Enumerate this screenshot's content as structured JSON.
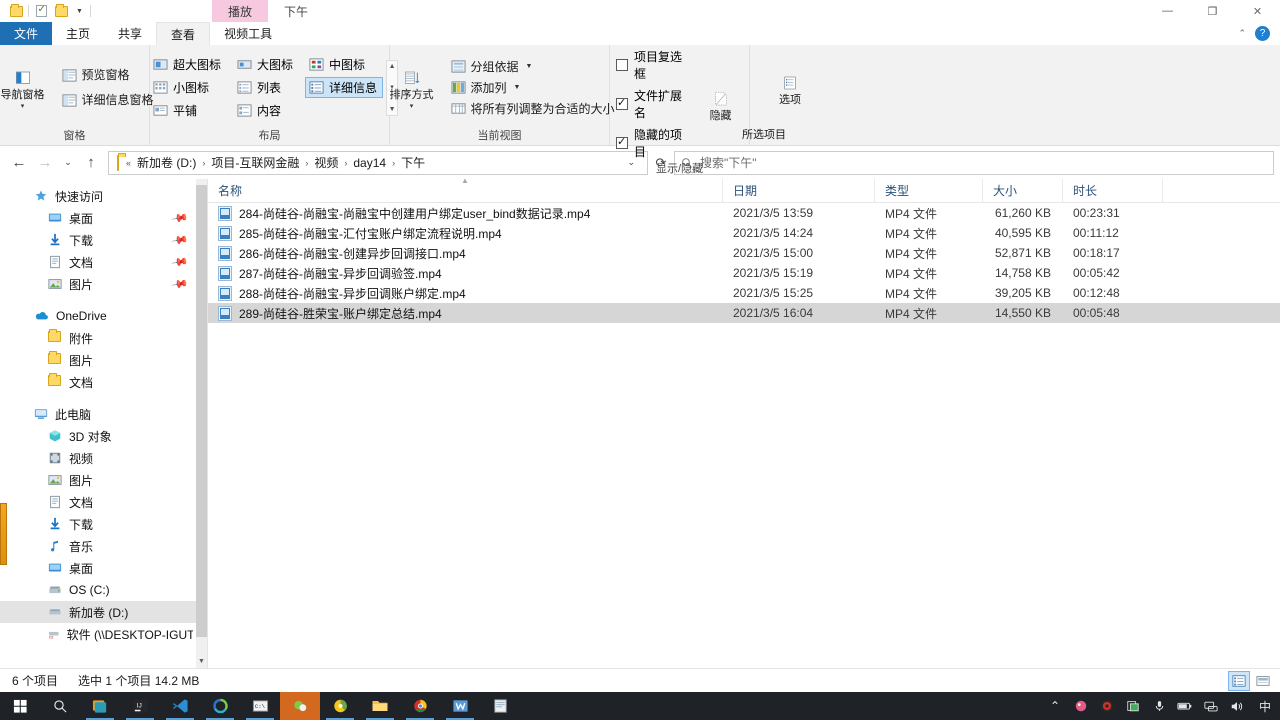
{
  "window": {
    "quick_access": [
      "folder-icon",
      "properties-icon",
      "new-folder-icon",
      "customize-caret"
    ],
    "contextual_tabs": [
      {
        "label": "播放",
        "kind": "contextual"
      },
      {
        "label": "下午",
        "kind": "title"
      }
    ],
    "controls": {
      "minimize": "—",
      "maximize": "❐",
      "close": "✕"
    }
  },
  "ribbon": {
    "tabs": [
      {
        "label": "文件",
        "state": "file"
      },
      {
        "label": "主页",
        "state": "normal"
      },
      {
        "label": "共享",
        "state": "normal"
      },
      {
        "label": "查看",
        "state": "active"
      },
      {
        "label": "视频工具",
        "state": "contextual"
      }
    ],
    "collapse_icon": "chevron-up-icon",
    "help_icon": "help-icon",
    "groups": [
      {
        "name": "窗格",
        "big_button": {
          "label": "导航窗格",
          "caret": "▾"
        },
        "items": [
          {
            "label": "预览窗格"
          },
          {
            "label": "详细信息窗格"
          }
        ]
      },
      {
        "name": "布局",
        "views": [
          {
            "label": "超大图标",
            "selected": false
          },
          {
            "label": "大图标",
            "selected": false
          },
          {
            "label": "中图标",
            "selected": false
          },
          {
            "label": "小图标",
            "selected": false
          },
          {
            "label": "列表",
            "selected": false
          },
          {
            "label": "详细信息",
            "selected": true
          },
          {
            "label": "平铺",
            "selected": false
          },
          {
            "label": "内容",
            "selected": false
          }
        ]
      },
      {
        "name": "当前视图",
        "big_button": {
          "label": "排序方式",
          "caret": "▾"
        },
        "items": [
          {
            "label": "分组依据",
            "dropdown": true
          },
          {
            "label": "添加列",
            "dropdown": true
          },
          {
            "label": "将所有列调整为合适的大小",
            "dropdown": false
          }
        ]
      },
      {
        "name": "显示/隐藏",
        "checkboxes": [
          {
            "label": "项目复选框",
            "checked": false
          },
          {
            "label": "文件扩展名",
            "checked": true
          },
          {
            "label": "隐藏的项目",
            "checked": true
          }
        ],
        "hide_button": {
          "line1": "隐藏",
          "line2": "所选项目"
        }
      },
      {
        "name": "",
        "options_button": {
          "label": "选项"
        }
      }
    ]
  },
  "address_bar": {
    "back_icon": "back-arrow-icon",
    "forward_icon": "forward-arrow-icon",
    "recent_icon": "chevron-down-icon",
    "up_icon": "up-arrow-icon",
    "folder_icon": "folder-icon",
    "overflow": "«",
    "crumbs": [
      "新加卷 (D:)",
      "项目-互联网金融",
      "视频",
      "day14",
      "下午"
    ],
    "dropdown_caret": "⌄",
    "refresh_icon": "refresh-icon",
    "search": {
      "icon": "search-icon",
      "placeholder": "搜索\"下午\""
    }
  },
  "nav_pane": {
    "groups": [
      {
        "header": {
          "label": "快速访问",
          "icon": "pin-star-icon"
        },
        "items": [
          {
            "label": "桌面",
            "icon": "desktop-icon",
            "pinned": true
          },
          {
            "label": "下载",
            "icon": "download-icon",
            "pinned": true
          },
          {
            "label": "文档",
            "icon": "document-icon",
            "pinned": true
          },
          {
            "label": "图片",
            "icon": "pictures-icon",
            "pinned": true
          }
        ]
      },
      {
        "header": {
          "label": "OneDrive",
          "icon": "onedrive-cloud-icon"
        },
        "items": [
          {
            "label": "附件",
            "icon": "folder-icon",
            "pinned": false
          },
          {
            "label": "图片",
            "icon": "folder-icon",
            "pinned": false
          },
          {
            "label": "文档",
            "icon": "folder-icon",
            "pinned": false
          }
        ]
      },
      {
        "header": {
          "label": "此电脑",
          "icon": "this-pc-icon"
        },
        "items": [
          {
            "label": "3D 对象",
            "icon": "3d-objects-icon",
            "pinned": false
          },
          {
            "label": "视频",
            "icon": "videos-icon",
            "pinned": false
          },
          {
            "label": "图片",
            "icon": "pictures-icon",
            "pinned": false
          },
          {
            "label": "文档",
            "icon": "document-icon",
            "pinned": false
          },
          {
            "label": "下载",
            "icon": "download-icon",
            "pinned": false
          },
          {
            "label": "音乐",
            "icon": "music-icon",
            "pinned": false
          },
          {
            "label": "桌面",
            "icon": "desktop-icon",
            "pinned": false
          },
          {
            "label": "OS (C:)",
            "icon": "drive-icon",
            "pinned": false
          },
          {
            "label": "新加卷 (D:)",
            "icon": "drive-icon",
            "pinned": false,
            "selected": true
          },
          {
            "label": "软件 (\\\\DESKTOP-IGUTNAF",
            "icon": "network-drive-icon",
            "pinned": false
          }
        ]
      }
    ],
    "scrollbar": {
      "up": "▲",
      "down": "▼"
    }
  },
  "file_list": {
    "columns": [
      {
        "label": "名称",
        "sorted": "asc"
      },
      {
        "label": "日期"
      },
      {
        "label": "类型"
      },
      {
        "label": "大小"
      },
      {
        "label": "时长"
      }
    ],
    "sort_indicator": "▲",
    "rows": [
      {
        "name": "284-尚硅谷-尚融宝-尚融宝中创建用户绑定user_bind数据记录.mp4",
        "date": "2021/3/5 13:59",
        "type": "MP4 文件",
        "size": "61,260 KB",
        "duration": "00:23:31",
        "selected": false
      },
      {
        "name": "285-尚硅谷-尚融宝-汇付宝账户绑定流程说明.mp4",
        "date": "2021/3/5 14:24",
        "type": "MP4 文件",
        "size": "40,595 KB",
        "duration": "00:11:12",
        "selected": false
      },
      {
        "name": "286-尚硅谷-尚融宝-创建异步回调接口.mp4",
        "date": "2021/3/5 15:00",
        "type": "MP4 文件",
        "size": "52,871 KB",
        "duration": "00:18:17",
        "selected": false
      },
      {
        "name": "287-尚硅谷-尚融宝-异步回调验签.mp4",
        "date": "2021/3/5 15:19",
        "type": "MP4 文件",
        "size": "14,758 KB",
        "duration": "00:05:42",
        "selected": false
      },
      {
        "name": "288-尚硅谷-尚融宝-异步回调账户绑定.mp4",
        "date": "2021/3/5 15:25",
        "type": "MP4 文件",
        "size": "39,205 KB",
        "duration": "00:12:48",
        "selected": false
      },
      {
        "name": "289-尚硅谷-胜荣宝-账户绑定总结.mp4",
        "date": "2021/3/5 16:04",
        "type": "MP4 文件",
        "size": "14,550 KB",
        "duration": "00:05:48",
        "selected": true
      }
    ]
  },
  "status_bar": {
    "item_count": "6 个项目",
    "selection": "选中 1 个项目  14.2 MB",
    "view_details_icon": "details-view-icon",
    "view_tiles_icon": "tiles-view-icon"
  },
  "taskbar": {
    "start_icon": "windows-start-icon",
    "search_icon": "search-icon",
    "apps": [
      {
        "icon": "task-view-icon",
        "running": true,
        "active": false
      },
      {
        "icon": "intellij-idea-icon",
        "running": true,
        "active": false
      },
      {
        "icon": "vscode-icon",
        "running": true,
        "active": false
      },
      {
        "icon": "sourcetree-icon",
        "running": true,
        "active": false
      },
      {
        "icon": "terminal-icon",
        "running": true,
        "active": false
      },
      {
        "icon": "potplayer-icon",
        "running": true,
        "active": true
      },
      {
        "icon": "browser-icon",
        "running": true,
        "active": false
      },
      {
        "icon": "file-explorer-icon",
        "running": true,
        "active": false
      },
      {
        "icon": "chrome-icon",
        "running": true,
        "active": false
      },
      {
        "icon": "wechat-icon",
        "running": true,
        "active": false
      },
      {
        "icon": "notepad-icon",
        "running": false,
        "active": false
      }
    ],
    "tray": [
      {
        "icon": "chevron-up-icon"
      },
      {
        "icon": "app-tray-icon"
      },
      {
        "icon": "obs-icon"
      },
      {
        "icon": "clipboard-icon"
      },
      {
        "icon": "microphone-icon"
      },
      {
        "icon": "battery-icon"
      },
      {
        "icon": "network-icon"
      },
      {
        "icon": "volume-icon"
      },
      {
        "icon": "ime-icon",
        "label": "中"
      }
    ]
  },
  "colors": {
    "file_tab_blue": "#1f6fb5",
    "contextual_pink": "#f6c9e0",
    "selection_gray": "#d6d6d6",
    "ribbon_bg": "#f2f2f2",
    "taskbar_bg": "#1f2327",
    "active_task_orange": "#d2691e"
  }
}
